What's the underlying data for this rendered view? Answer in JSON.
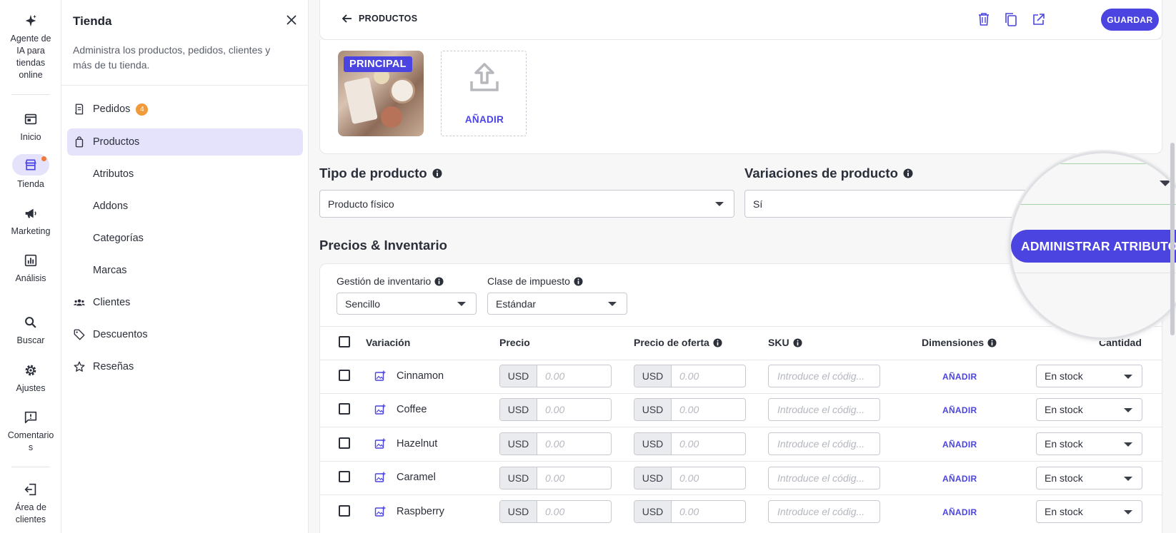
{
  "rail": {
    "items": [
      {
        "label": "Agente de IA para tiendas online",
        "icon": "sparkle-icon"
      },
      {
        "label": "Inicio",
        "icon": "home-icon"
      },
      {
        "label": "Tienda",
        "icon": "store-icon"
      },
      {
        "label": "Marketing",
        "icon": "megaphone-icon"
      },
      {
        "label": "Análisis",
        "icon": "analytics-icon"
      },
      {
        "label": "Buscar",
        "icon": "search-icon"
      },
      {
        "label": "Ajustes",
        "icon": "gear-icon"
      },
      {
        "label": "Comentarios",
        "icon": "feedback-icon"
      },
      {
        "label": "Área de clientes",
        "icon": "logout-icon"
      }
    ]
  },
  "panel": {
    "title": "Tienda",
    "description": "Administra los productos, pedidos, clientes y más de tu tienda.",
    "nav": [
      {
        "label": "Pedidos",
        "badge": "4",
        "icon": "orders-icon"
      },
      {
        "label": "Productos",
        "icon": "bag-icon",
        "active": true
      },
      {
        "label": "Atributos"
      },
      {
        "label": "Addons"
      },
      {
        "label": "Categorías"
      },
      {
        "label": "Marcas"
      },
      {
        "label": "Clientes",
        "icon": "users-icon"
      },
      {
        "label": "Descuentos",
        "icon": "tag-icon"
      },
      {
        "label": "Reseñas",
        "icon": "star-icon"
      }
    ]
  },
  "topbar": {
    "back_label": "PRODUCTOS",
    "save_label": "GUARDAR"
  },
  "media": {
    "principal_label": "PRINCIPAL",
    "add_label": "AÑADIR"
  },
  "product_type": {
    "label": "Tipo de producto",
    "value": "Producto físico"
  },
  "variations": {
    "label": "Variaciones de producto",
    "value": "Sí"
  },
  "pricing": {
    "title": "Precios & Inventario",
    "manage_attributes_label": "ADMINISTRAR ATRIBUTOS",
    "inventory_label": "Gestión de inventario",
    "inventory_value": "Sencillo",
    "tax_label": "Clase de impuesto",
    "tax_value": "Estándar"
  },
  "table": {
    "headers": {
      "variation": "Variación",
      "price": "Precio",
      "sale_price": "Precio de oferta",
      "sku": "SKU",
      "dimensions": "Dimensiones",
      "quantity": "Cantidad"
    },
    "currency": "USD",
    "price_placeholder": "0.00",
    "sku_placeholder": "Introduce el códig...",
    "dimensions_add": "AÑADIR",
    "rows": [
      {
        "name": "Cinnamon",
        "stock": "En stock"
      },
      {
        "name": "Coffee",
        "stock": "En stock"
      },
      {
        "name": "Hazelnut",
        "stock": "En stock"
      },
      {
        "name": "Caramel",
        "stock": "En stock"
      },
      {
        "name": "Raspberry",
        "stock": "En stock"
      }
    ]
  },
  "colors": {
    "accent": "#4b44e0",
    "active_bg": "#e4e3fb",
    "badge": "#f09a3a"
  }
}
